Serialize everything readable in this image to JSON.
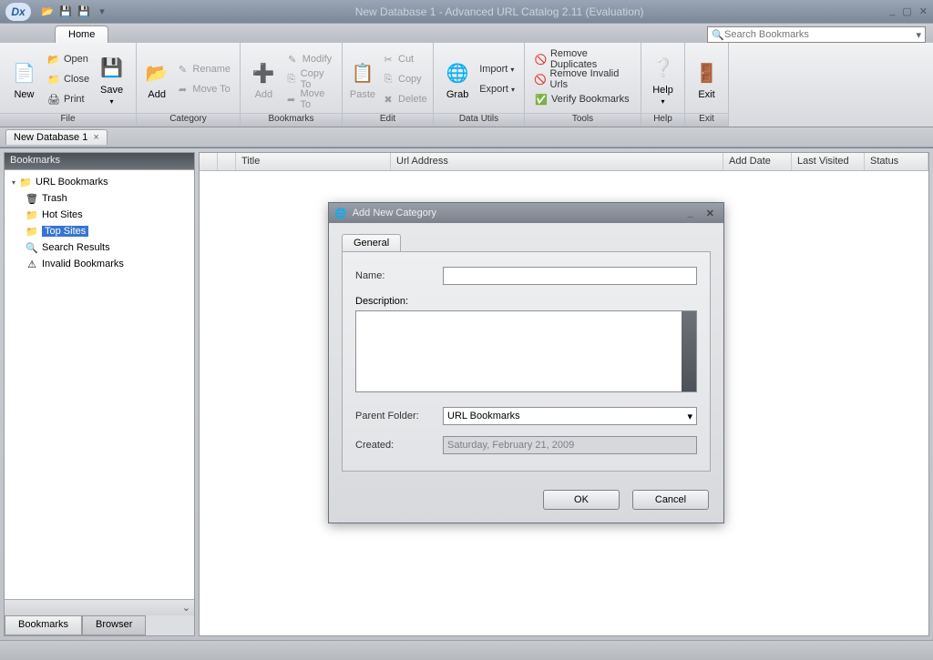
{
  "window": {
    "title": "New Database 1 - Advanced URL Catalog 2.11 (Evaluation)"
  },
  "search": {
    "placeholder": "Search Bookmarks"
  },
  "tabs": {
    "home": "Home"
  },
  "ribbon": {
    "file": {
      "label": "File",
      "new": "New",
      "open": "Open",
      "close": "Close",
      "print": "Print",
      "save": "Save"
    },
    "category": {
      "label": "Category",
      "add": "Add",
      "rename": "Rename",
      "moveto": "Move To"
    },
    "bookmarks": {
      "label": "Bookmarks",
      "add": "Add",
      "modify": "Modify",
      "copyto": "Copy To",
      "moveto": "Move To"
    },
    "edit": {
      "label": "Edit",
      "paste": "Paste",
      "cut": "Cut",
      "copy": "Copy",
      "delete": "Delete"
    },
    "datautils": {
      "label": "Data Utils",
      "grab": "Grab",
      "import": "Import",
      "export": "Export"
    },
    "tools": {
      "label": "Tools",
      "rmdup": "Remove Duplicates",
      "rminv": "Remove Invalid Urls",
      "verify": "Verify Bookmarks"
    },
    "help": {
      "label": "Help",
      "help": "Help"
    },
    "exit": {
      "label": "Exit",
      "exit": "Exit"
    }
  },
  "docTab": {
    "name": "New Database 1"
  },
  "sidebar": {
    "title": "Bookmarks",
    "items": [
      {
        "label": "URL Bookmarks",
        "icon": "folder",
        "child": false,
        "sel": false
      },
      {
        "label": "Trash",
        "icon": "trash",
        "child": true,
        "sel": false
      },
      {
        "label": "Hot Sites",
        "icon": "folder",
        "child": true,
        "sel": false
      },
      {
        "label": "Top Sites",
        "icon": "folder",
        "child": true,
        "sel": true
      },
      {
        "label": "Search Results",
        "icon": "search",
        "child": true,
        "sel": false
      },
      {
        "label": "Invalid Bookmarks",
        "icon": "warn",
        "child": true,
        "sel": false
      }
    ],
    "tab1": "Bookmarks",
    "tab2": "Browser"
  },
  "columns": {
    "title": "Title",
    "url": "Url Address",
    "add": "Add Date",
    "visit": "Last Visited",
    "status": "Status"
  },
  "dialog": {
    "title": "Add New Category",
    "tab": "General",
    "name_label": "Name:",
    "desc_label": "Description:",
    "parent_label": "Parent Folder:",
    "parent_value": "URL Bookmarks",
    "created_label": "Created:",
    "created_value": "Saturday, February 21, 2009",
    "ok": "OK",
    "cancel": "Cancel"
  }
}
